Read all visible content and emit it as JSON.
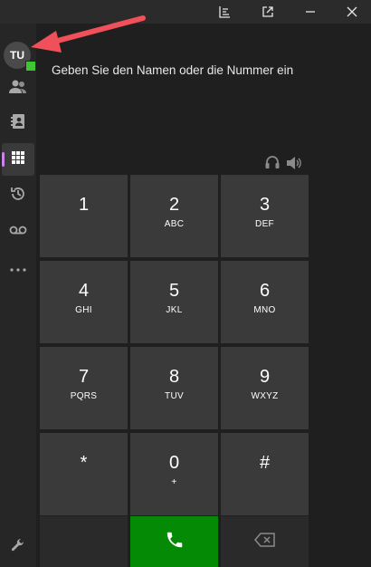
{
  "avatar": {
    "initials": "TU",
    "status_color": "#3ec532"
  },
  "dialpad": {
    "placeholder": "Geben Sie den Namen oder die Nummer ein",
    "keys": [
      {
        "digit": "1",
        "letters": ""
      },
      {
        "digit": "2",
        "letters": "ABC"
      },
      {
        "digit": "3",
        "letters": "DEF"
      },
      {
        "digit": "4",
        "letters": "GHI"
      },
      {
        "digit": "5",
        "letters": "JKL"
      },
      {
        "digit": "6",
        "letters": "MNO"
      },
      {
        "digit": "7",
        "letters": "PQRS"
      },
      {
        "digit": "8",
        "letters": "TUV"
      },
      {
        "digit": "9",
        "letters": "WXYZ"
      },
      {
        "digit": "*",
        "letters": ""
      },
      {
        "digit": "0",
        "letters": "+"
      },
      {
        "digit": "#",
        "letters": ""
      }
    ]
  },
  "sidebar": {
    "items": [
      {
        "icon": "contacts-icon"
      },
      {
        "icon": "address-book-icon"
      },
      {
        "icon": "dialpad-icon",
        "active": true
      },
      {
        "icon": "history-icon"
      },
      {
        "icon": "voicemail-icon"
      },
      {
        "icon": "more-icon"
      }
    ],
    "settings_icon": "wrench-icon"
  },
  "titlebar": {
    "icons": [
      "chart-icon",
      "popout-icon",
      "minimize-icon",
      "close-icon"
    ]
  },
  "colors": {
    "call": "#058a05",
    "accent": "#c785e8",
    "annotation_arrow": "#f0505a"
  }
}
